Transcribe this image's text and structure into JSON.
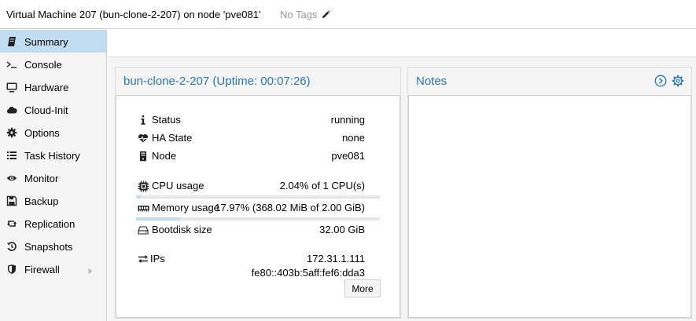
{
  "header": {
    "title": "Virtual Machine 207 (bun-clone-2-207) on node 'pve081'",
    "tags": "No Tags",
    "edit_icon": "pencil-icon"
  },
  "sidebar": {
    "items": [
      {
        "label": "Summary",
        "icon": "book-icon",
        "selected": true
      },
      {
        "label": "Console",
        "icon": "terminal-icon"
      },
      {
        "label": "Hardware",
        "icon": "monitor-icon"
      },
      {
        "label": "Cloud-Init",
        "icon": "cloud-icon"
      },
      {
        "label": "Options",
        "icon": "gear-icon"
      },
      {
        "label": "Task History",
        "icon": "list-icon"
      },
      {
        "label": "Monitor",
        "icon": "eye-icon"
      },
      {
        "label": "Backup",
        "icon": "floppy-icon"
      },
      {
        "label": "Replication",
        "icon": "retweet-icon"
      },
      {
        "label": "Snapshots",
        "icon": "history-icon"
      },
      {
        "label": "Firewall",
        "icon": "shield-icon",
        "expandable": true
      }
    ]
  },
  "status_panel": {
    "title": "bun-clone-2-207 (Uptime: 00:07:26)",
    "status_label": "Status",
    "status_value": "running",
    "ha_label": "HA State",
    "ha_value": "none",
    "node_label": "Node",
    "node_value": "pve081",
    "cpu_label": "CPU usage",
    "cpu_value": "2.04% of 1 CPU(s)",
    "cpu_fraction": 0.0204,
    "mem_label": "Memory usage",
    "mem_value": "17.97% (368.02 MiB of 2.00 GiB)",
    "mem_fraction": 0.1797,
    "disk_label": "Bootdisk size",
    "disk_value": "32.00 GiB",
    "ips_label": "IPs",
    "ip_v4": "172.31.1.111",
    "ip_v6": "fe80::403b:5aff:fef6:dda3",
    "more_label": "More"
  },
  "notes_panel": {
    "title": "Notes"
  },
  "colors": {
    "accent": "#2b75b8",
    "selected": "#c2ddf2"
  }
}
